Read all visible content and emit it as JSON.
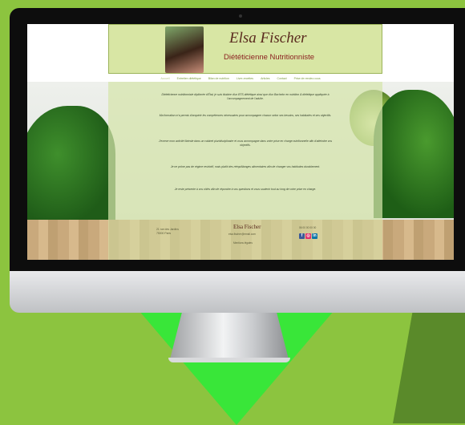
{
  "colors": {
    "accent": "#8cc43f",
    "card": "#d8e6a4",
    "title": "#5a2a1e",
    "subtitle": "#8a1e1e"
  },
  "site": {
    "name": "Elsa Fischer",
    "subtitle": "Diététicienne Nutritionniste"
  },
  "nav": [
    "Accueil",
    "Entretien diététique",
    "Bilan de nutrition",
    "Livre-recettes",
    "Articles",
    "Contact",
    "Prise de rendez-vous"
  ],
  "content": {
    "paragraphs": [
      "Diététicienne nutritionniste diplômée d'État, je suis titulaire d'un BTS diététique ainsi que d'un Bachelor en nutrition & diététique appliquée à l'accompagnement de l'adulte.",
      "Ma formation m'a permis d'acquérir les compétences nécessaires pour accompagner chacun selon ses besoins, ses habitudes et ses objectifs.",
      "J'exerce mon activité libérale dans un cabinet pluridisciplinaire et vous accompagne dans votre prise en charge nutritionnelle afin d'atteindre vos objectifs.",
      "Je ne prône pas de régime restrictif, mais plutôt des rééquilibrages alimentaires afin de changer vos habitudes durablement.",
      "Je reste présente à vos côtés afin de répondre à vos questions et vous soutenir tout au long de votre prise en charge."
    ]
  },
  "footer": {
    "address": [
      "21 rue des Jardins",
      "75000 Paris"
    ],
    "name": "Elsa Fischer",
    "email": "elsa.fischer@email.com",
    "legal": "Mentions légales",
    "tel": "06 00 00 00 00",
    "socials": [
      {
        "icon": "facebook-icon",
        "glyph": "f"
      },
      {
        "icon": "instagram-icon",
        "glyph": "◎"
      },
      {
        "icon": "linkedin-icon",
        "glyph": "in"
      }
    ]
  }
}
